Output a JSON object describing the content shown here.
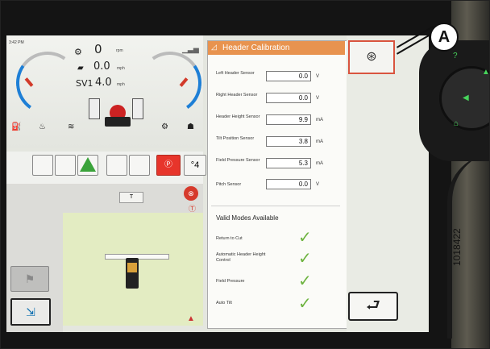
{
  "status": {
    "time": "3:42 PM",
    "rpm_value": "0",
    "rpm_unit": "rpm",
    "speed_value": "0.0",
    "speed_unit": "mph",
    "sv_label": "SV1",
    "sv_value": "4.0",
    "sv_unit": "mph",
    "hitch_label": "4"
  },
  "map": {
    "chip_label": "T"
  },
  "calibration": {
    "title": "Header Calibration",
    "sensors": [
      {
        "label": "Left Header Sensor",
        "value": "0.0",
        "unit": "V"
      },
      {
        "label": "Right Header Sensor",
        "value": "0.0",
        "unit": "V"
      },
      {
        "label": "Header Height Sensor",
        "value": "9.9",
        "unit": "mA"
      },
      {
        "label": "Tilt Position Sensor",
        "value": "3.8",
        "unit": "mA"
      },
      {
        "label": "Field Pressure Sensor",
        "value": "5.3",
        "unit": "mA"
      },
      {
        "label": "Pitch Sensor",
        "value": "0.0",
        "unit": "V"
      }
    ],
    "modes_title": "Valid Modes Available",
    "modes": [
      {
        "label": "Return to Cut"
      },
      {
        "label": "Automatic Header Height Control"
      },
      {
        "label": "Field Pressure"
      },
      {
        "label": "Auto Tilt"
      }
    ]
  },
  "callout": {
    "label": "A"
  },
  "figure": {
    "id": "1018422"
  },
  "icons": {
    "target": "header-target-icon",
    "back": "back-arrow-icon",
    "warning": "warning-triangle-icon",
    "park": "park-brake-icon",
    "fault": "fault-icon",
    "compass": "north-arrow-icon"
  }
}
